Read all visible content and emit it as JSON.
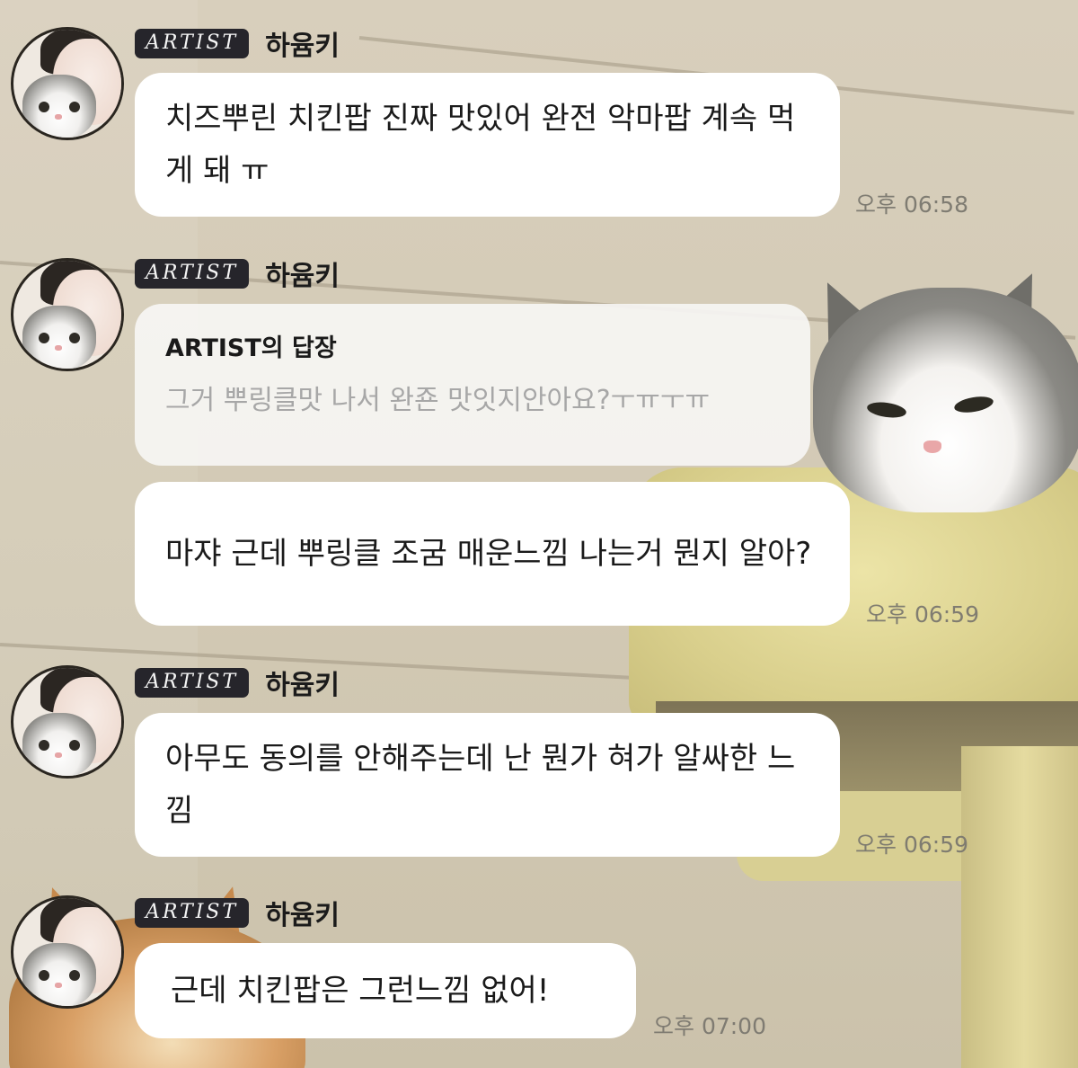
{
  "messages": [
    {
      "badge": "ARTIST",
      "sender": "하윰키",
      "text": "치즈뿌린 치킨팝 진짜 맛있어 완전 악마팝 계속 먹게 돼 ㅠ",
      "time": "오후 06:58"
    },
    {
      "badge": "ARTIST",
      "sender": "하윰키",
      "reply_title": "ARTIST의 답장",
      "reply_quote": "그거 뿌링클맛 나서 완죤 맛잇지안아요?ㅜㅠㅜㅠ",
      "text": "마쟈 근데 뿌링클 조굼 매운느낌 나는거 뭔지 알아?",
      "time": "오후 06:59"
    },
    {
      "badge": "ARTIST",
      "sender": "하윰키",
      "text": "아무도 동의를 안해주는데 난 뭔가 혀가 알싸한 느낌",
      "time": "오후 06:59"
    },
    {
      "badge": "ARTIST",
      "sender": "하윰키",
      "text": "근데 치킨팝은 그런느낌 없어!",
      "time": "오후 07:00"
    }
  ],
  "icons": {
    "avatar": "profile-photo-avatar",
    "background": "cat-photo-wallpaper"
  }
}
